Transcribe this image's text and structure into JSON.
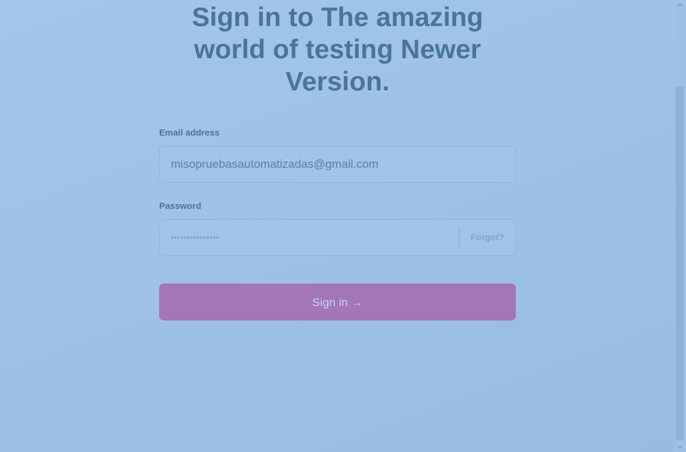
{
  "page": {
    "title": "Sign in to The amazing world of testing Newer Version."
  },
  "form": {
    "email_label": "Email address",
    "email_value": "misopruebasautomatizadas@gmail.com",
    "password_label": "Password",
    "password_masked": "•••••••••••••••",
    "forgot_label": "Forgot?",
    "submit_label": "Sign in →"
  },
  "colors": {
    "background": "#9ec1e6",
    "title": "#4a7599",
    "button": "#a276b9",
    "button_text": "#c4d6f0"
  }
}
